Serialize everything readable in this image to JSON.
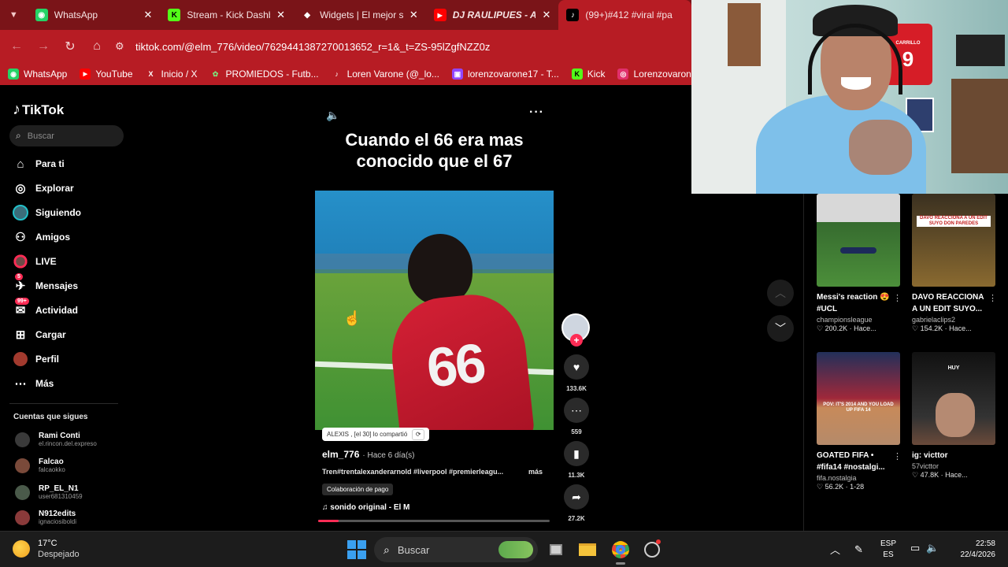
{
  "browser": {
    "tabs": [
      {
        "title": "WhatsApp",
        "icon": "whatsapp-icon",
        "color": "#25d366",
        "glyph": "◉"
      },
      {
        "title": "Stream - Kick Dashbo",
        "icon": "kick-icon",
        "color": "#53fc18",
        "glyph": "K"
      },
      {
        "title": "Widgets | El mejor so",
        "icon": "widgets-icon",
        "color": "#ffffff",
        "glyph": "◆"
      },
      {
        "title": "DJ RAULIPUES - AN",
        "icon": "youtube-icon",
        "color": "#ff0000",
        "glyph": "▶"
      },
      {
        "title": "(99+)#412 #viral #pa",
        "icon": "tiktok-icon",
        "color": "#000000",
        "glyph": "♪"
      }
    ],
    "url": "tiktok.com/@elm_776/video/7629441387270013652_r=1&_t=ZS-95lZgfNZZ0z",
    "bookmarks": [
      {
        "label": "WhatsApp",
        "icon": "whatsapp-icon",
        "color": "#25d366",
        "glyph": "◉"
      },
      {
        "label": "YouTube",
        "icon": "youtube-icon",
        "color": "#ff0000",
        "glyph": "▶"
      },
      {
        "label": "Inicio / X",
        "icon": "x-icon",
        "color": "#000000",
        "glyph": "X"
      },
      {
        "label": "PROMIEDOS - Futb...",
        "icon": "promiedos-icon",
        "color": "#2e9b3a",
        "glyph": "✿"
      },
      {
        "label": "Loren Varone (@_lo...",
        "icon": "tiktok-icon",
        "color": "#000000",
        "glyph": "♪"
      },
      {
        "label": "lorenzovarone17 - T...",
        "icon": "twitch-icon",
        "color": "#9146ff",
        "glyph": "▣"
      },
      {
        "label": "Kick",
        "icon": "kick-icon",
        "color": "#53fc18",
        "glyph": "K"
      },
      {
        "label": "Lorenzovarone (Inst...",
        "icon": "instagram-icon",
        "color": "#e1306c",
        "glyph": "◎"
      }
    ]
  },
  "sidebar": {
    "brand": "TikTok",
    "search_placeholder": "Buscar",
    "items": [
      {
        "label": "Para ti",
        "icon": "home-icon"
      },
      {
        "label": "Explorar",
        "icon": "compass-icon"
      },
      {
        "label": "Siguiendo",
        "icon": "following-icon"
      },
      {
        "label": "Amigos",
        "icon": "friends-icon"
      },
      {
        "label": "LIVE",
        "icon": "live-icon"
      },
      {
        "label": "Mensajes",
        "icon": "messages-icon",
        "badge": "5"
      },
      {
        "label": "Actividad",
        "icon": "activity-icon",
        "badge": "99+"
      },
      {
        "label": "Cargar",
        "icon": "upload-icon"
      },
      {
        "label": "Perfil",
        "icon": "profile-icon"
      },
      {
        "label": "Más",
        "icon": "more-icon"
      }
    ],
    "following_title": "Cuentas que sigues",
    "following": [
      {
        "name": "Rami Conti",
        "handle": "el.rincon.del.expreso"
      },
      {
        "name": "Falcao",
        "handle": "falcaokko"
      },
      {
        "name": "RP_EL_N1",
        "handle": "user681310459"
      },
      {
        "name": "N912edits",
        "handle": "ignaciosiboldi"
      }
    ]
  },
  "video": {
    "caption_line1": "Cuando el 66 era mas",
    "caption_line2": "conocido que el 67",
    "jersey_number": "66",
    "shared_by": "ALEXIS , [el 30] lo compartió",
    "author": "elm_776",
    "posted": "· Hace 6 día(s)",
    "description": "Tren#trentalexanderarnold #liverpool #premierleagu...",
    "more": "más",
    "collab": "Colaboración de pago",
    "sound": "♫  sonido original - El M",
    "progress": 0.09
  },
  "actions": {
    "likes": "133.6K",
    "comments": "559",
    "saves": "11.3K",
    "shares": "27.2K"
  },
  "recommendations": [
    {
      "title": "Messi's reaction 😍 #UCL",
      "user": "championsleague",
      "stats": "♡ 200.2K · Hace..."
    },
    {
      "title": "DAVO REACCIONA A UN EDIT SUYO...",
      "user": "gabrielaclips2",
      "stats": "♡ 154.2K · Hace..."
    },
    {
      "title": "GOATED FIFA • #fifa14 #nostalgi...",
      "user": "fifa.nostalgia",
      "stats": "♡ 56.2K · 1-28"
    },
    {
      "title": "ig: victtor",
      "user": "57victtor",
      "stats": "♡ 47.8K · Hace..."
    }
  ],
  "thumb_texts": {
    "davo": "DAVO REACCIONA A UN EDIT SUYO DON PAREDES",
    "fifa": "POV: IT'S 2014 AND YOU LOAD UP FIFA 14",
    "huy": "HUY"
  },
  "webcam": {
    "jersey_name": "CARRILLO",
    "jersey_number": "9"
  },
  "taskbar": {
    "temperature": "17°C",
    "weather": "Despejado",
    "search_placeholder": "Buscar",
    "lang1": "ESP",
    "lang2": "ES",
    "time": "22:58",
    "date": "22/4/2026"
  }
}
